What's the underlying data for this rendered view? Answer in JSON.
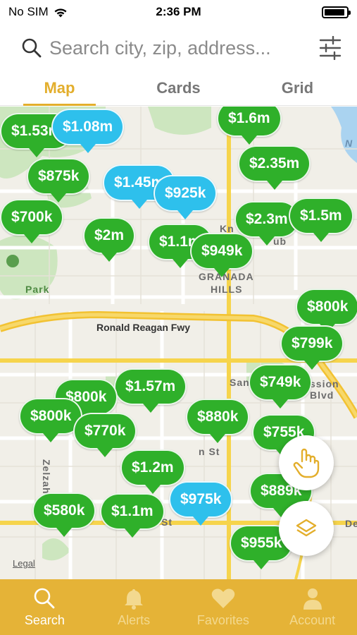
{
  "status_bar": {
    "carrier": "No SIM",
    "time": "2:36 PM"
  },
  "search": {
    "placeholder": "Search city, zip, address..."
  },
  "tabs": [
    {
      "label": "Map",
      "active": true
    },
    {
      "label": "Cards",
      "active": false
    },
    {
      "label": "Grid",
      "active": false
    }
  ],
  "map": {
    "labels": {
      "granada": "GRANADA",
      "hills": "HILLS",
      "freeway": "Ronald Reagan Fwy",
      "park": "Park",
      "san": "San",
      "blvd": "ssion Blvd",
      "st1": "n St",
      "st2": "St",
      "kn": "Kn",
      "ub": "ub",
      "zelzah": "Zelzah",
      "north": "N",
      "de": "De",
      "legal": "Legal"
    },
    "pins": [
      {
        "price": "$1.53m",
        "color": "green"
      },
      {
        "price": "$1.08m",
        "color": "blue"
      },
      {
        "price": "$1.6m",
        "color": "green"
      },
      {
        "price": "$875k",
        "color": "green"
      },
      {
        "price": "$1.45m",
        "color": "blue"
      },
      {
        "price": "$925k",
        "color": "blue"
      },
      {
        "price": "$2.35m",
        "color": "green"
      },
      {
        "price": "$700k",
        "color": "green"
      },
      {
        "price": "$2m",
        "color": "green"
      },
      {
        "price": "$1.1m",
        "color": "green"
      },
      {
        "price": "$949k",
        "color": "green"
      },
      {
        "price": "$2.3m",
        "color": "green"
      },
      {
        "price": "$1.5m",
        "color": "green"
      },
      {
        "price": "$800k",
        "color": "green"
      },
      {
        "price": "$799k",
        "color": "green"
      },
      {
        "price": "$1.57m",
        "color": "green"
      },
      {
        "price": "$749k",
        "color": "green"
      },
      {
        "price": "$800k",
        "color": "green"
      },
      {
        "price": "$800k",
        "color": "green"
      },
      {
        "price": "$770k",
        "color": "green"
      },
      {
        "price": "$880k",
        "color": "green"
      },
      {
        "price": "$755k",
        "color": "green"
      },
      {
        "price": "$1.2m",
        "color": "green"
      },
      {
        "price": "$975k",
        "color": "blue"
      },
      {
        "price": "$889k",
        "color": "green"
      },
      {
        "price": "$580k",
        "color": "green"
      },
      {
        "price": "$1.1m",
        "color": "green"
      },
      {
        "price": "$955k",
        "color": "green"
      }
    ]
  },
  "fab": {
    "draw_icon": "hand-pointer-icon",
    "layers_icon": "layers-icon"
  },
  "bottom_nav": [
    {
      "label": "Search",
      "icon": "search-icon",
      "active": true
    },
    {
      "label": "Alerts",
      "icon": "bell-icon",
      "active": false
    },
    {
      "label": "Favorites",
      "icon": "heart-icon",
      "active": false
    },
    {
      "label": "Account",
      "icon": "person-icon",
      "active": false
    }
  ],
  "colors": {
    "accent": "#e3ae2c",
    "nav_bg": "#e5b337",
    "pin_green": "#2fb02a",
    "pin_blue": "#2ec0ec"
  }
}
